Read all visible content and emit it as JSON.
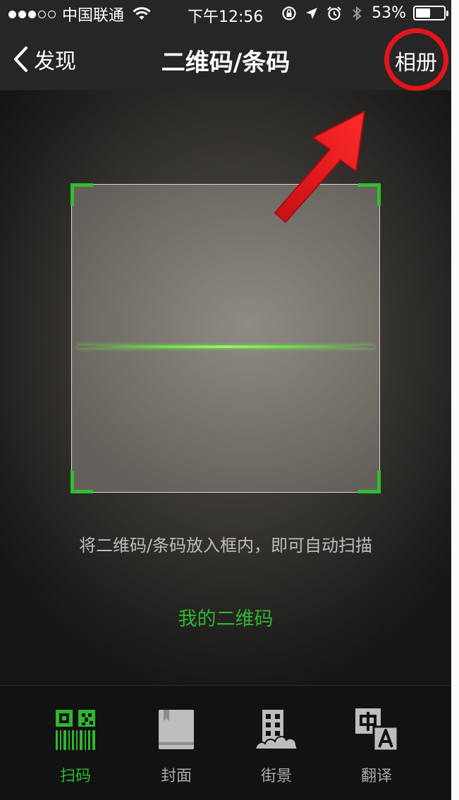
{
  "status_bar": {
    "carrier": "中国联通",
    "time": "下午12:56",
    "battery": "53%",
    "battery_level": 0.53,
    "icons": [
      "signal-dots-icon",
      "wifi-icon",
      "rotation-lock-icon",
      "location-arrow-icon",
      "alarm-icon",
      "bluetooth-icon",
      "battery-icon"
    ]
  },
  "nav": {
    "back_label": "发现",
    "title": "二维码/条码",
    "album_label": "相册"
  },
  "scanner": {
    "hint": "将二维码/条码放入框内，即可自动扫描",
    "my_qr_label": "我的二维码"
  },
  "tabs": [
    {
      "label": "扫码",
      "icon": "qr-barcode-icon",
      "active": true
    },
    {
      "label": "封面",
      "icon": "book-cover-icon",
      "active": false
    },
    {
      "label": "街景",
      "icon": "street-view-icon",
      "active": false
    },
    {
      "label": "翻译",
      "icon": "translate-icon",
      "active": false
    }
  ],
  "colors": {
    "accent_green": "#2eb82e",
    "annotation_red": "#e3141b",
    "bar_background": "#262626"
  }
}
